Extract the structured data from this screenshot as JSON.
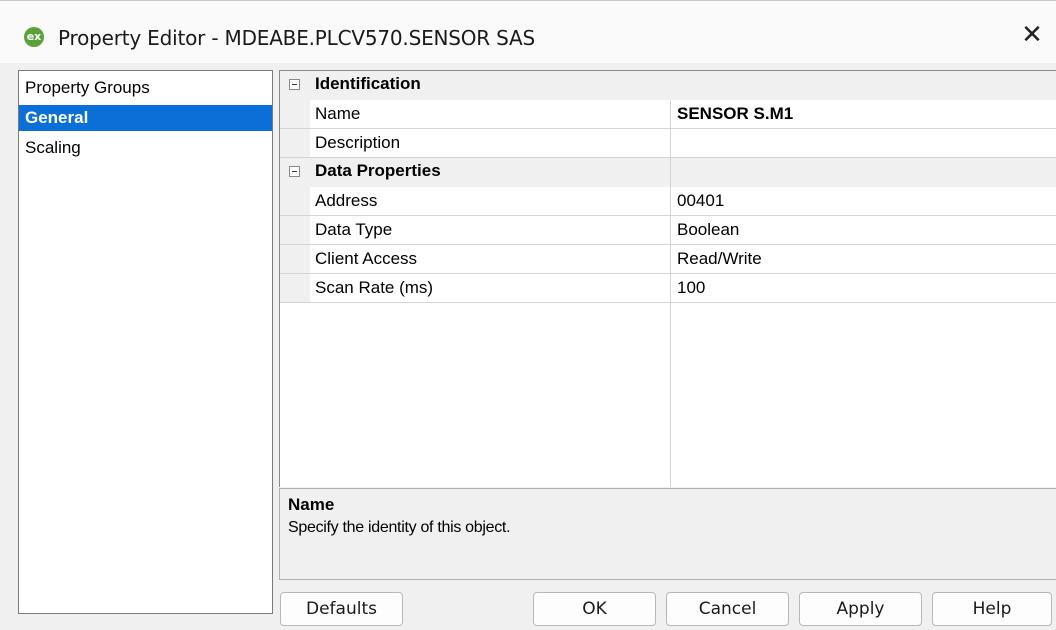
{
  "window": {
    "app_icon_text": "ex",
    "title": "Property Editor - MDEABE.PLCV570.SENSOR SAS",
    "close_symbol": "✕"
  },
  "property_groups": {
    "header": "Property Groups",
    "items": [
      {
        "label": "General",
        "selected": true
      },
      {
        "label": "Scaling",
        "selected": false
      }
    ]
  },
  "grid": {
    "categories": [
      {
        "label": "Identification",
        "properties": [
          {
            "name": "Name",
            "value": "SENSOR S.M1"
          },
          {
            "name": "Description",
            "value": ""
          }
        ]
      },
      {
        "label": "Data Properties",
        "properties": [
          {
            "name": "Address",
            "value": "00401"
          },
          {
            "name": "Data Type",
            "value": "Boolean"
          },
          {
            "name": "Client Access",
            "value": "Read/Write"
          },
          {
            "name": "Scan Rate (ms)",
            "value": "100"
          }
        ]
      }
    ]
  },
  "help": {
    "title": "Name",
    "text": "Specify the identity of this object."
  },
  "buttons": {
    "defaults": "Defaults",
    "ok": "OK",
    "cancel": "Cancel",
    "apply": "Apply",
    "help": "Help"
  },
  "colors": {
    "selection": "#0a6fd6",
    "background": "#f0f0f0"
  }
}
